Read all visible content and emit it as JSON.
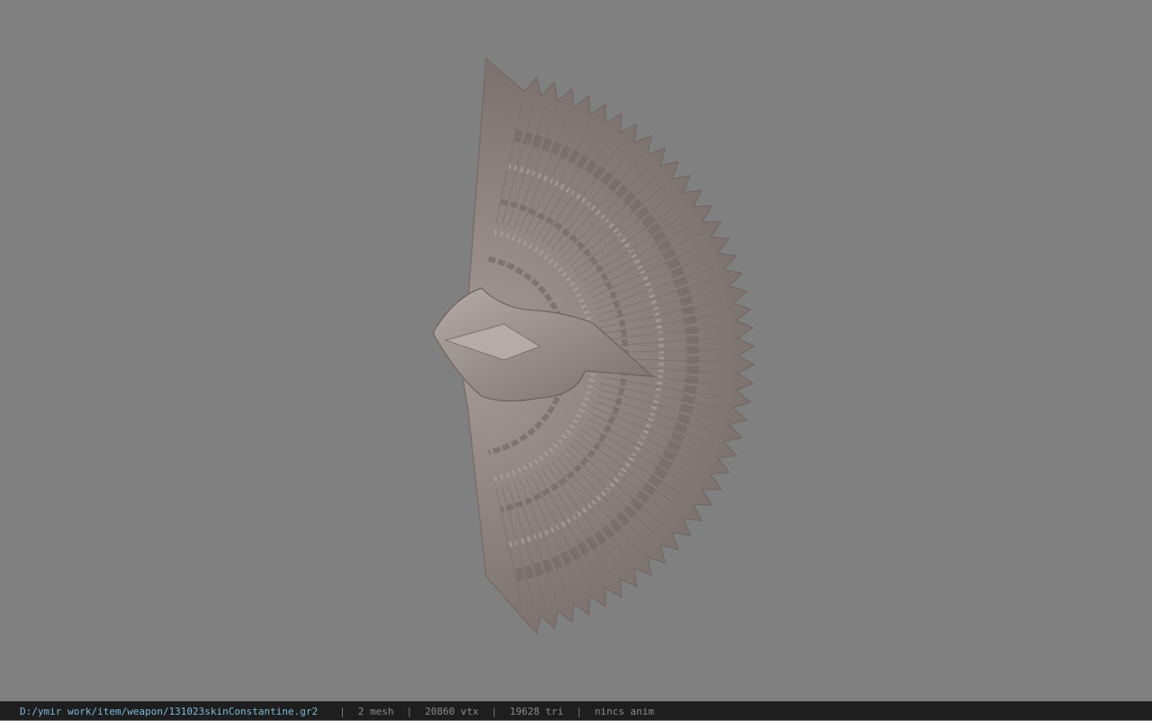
{
  "viewer": {
    "background_color": "#808080",
    "model_color": "#8c817d",
    "model_name": "fan-weapon-model"
  },
  "status": {
    "path": "D:/ymir work/item/weapon/131023skinConstantine.gr2",
    "mesh": "2 mesh",
    "vtx": "20860 vtx",
    "tri": "19628 tri",
    "anim": "nincs anim",
    "separator": "|"
  }
}
